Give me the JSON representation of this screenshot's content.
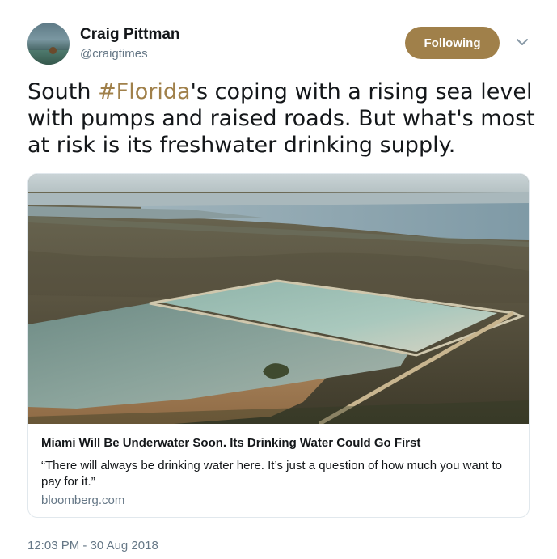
{
  "author": {
    "name": "Craig Pittman",
    "handle": "@craigtimes"
  },
  "follow_button": {
    "label": "Following",
    "color": "#a0804a"
  },
  "tweet": {
    "text_before": "South ",
    "hashtag": "#Florida",
    "text_after": "'s coping with a rising sea level with pumps and raised roads. But what's most at risk is its freshwater drinking supply."
  },
  "card": {
    "title": "Miami Will Be Underwater Soon. Its Drinking Water Could Go First",
    "description": "“There will always be drinking water here. It’s just a question of how much you want to pay for it.”",
    "domain": "bloomberg.com"
  },
  "timestamp": "12:03 PM - 30 Aug 2018",
  "icons": [
    "avatar",
    "chevron-down-icon"
  ]
}
